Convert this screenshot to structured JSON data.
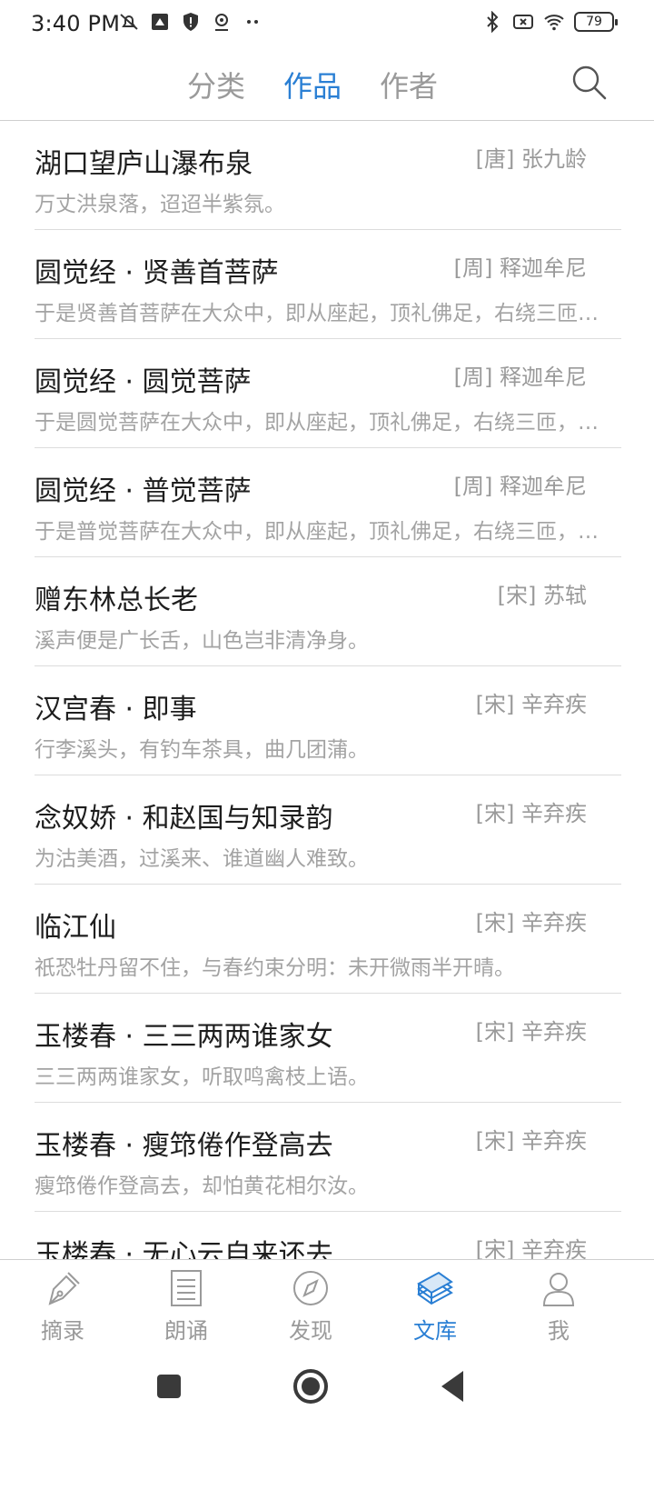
{
  "status_bar": {
    "time": "3:40 PM",
    "battery": "79",
    "left_icons": [
      "muted-notification-icon",
      "screen-record-icon",
      "shield-icon",
      "location-icon",
      "more-dots-icon"
    ],
    "right_icons": [
      "bluetooth-icon",
      "sim-error-icon",
      "wifi-icon",
      "battery-icon"
    ]
  },
  "header": {
    "tabs": [
      {
        "label": "分类",
        "active": false
      },
      {
        "label": "作品",
        "active": true
      },
      {
        "label": "作者",
        "active": false
      }
    ],
    "search_icon": "search-icon"
  },
  "works": [
    {
      "title": "湖口望庐山瀑布泉",
      "author": "[唐] 张九龄",
      "excerpt": "万丈洪泉落，迢迢半紫氛。"
    },
    {
      "title": "圆觉经 · 贤善首菩萨",
      "author": "[周] 释迦牟尼",
      "excerpt": "于是贤善首菩萨在大众中，即从座起，顶礼佛足，右绕三匝…"
    },
    {
      "title": "圆觉经 · 圆觉菩萨",
      "author": "[周] 释迦牟尼",
      "excerpt": "于是圆觉菩萨在大众中，即从座起，顶礼佛足，右绕三匝，…"
    },
    {
      "title": "圆觉经 · 普觉菩萨",
      "author": "[周] 释迦牟尼",
      "excerpt": "于是普觉菩萨在大众中，即从座起，顶礼佛足，右绕三匝，…"
    },
    {
      "title": "赠东林总长老",
      "author": "[宋] 苏轼",
      "excerpt": "溪声便是广长舌，山色岂非清净身。"
    },
    {
      "title": "汉宫春 · 即事",
      "author": "[宋] 辛弃疾",
      "excerpt": "行李溪头，有钓车茶具，曲几团蒲。"
    },
    {
      "title": "念奴娇 · 和赵国与知录韵",
      "author": "[宋] 辛弃疾",
      "excerpt": "为沽美酒，过溪来、谁道幽人难致。"
    },
    {
      "title": "临江仙",
      "author": "[宋] 辛弃疾",
      "excerpt": "祇恐牡丹留不住，与春约束分明：未开微雨半开晴。"
    },
    {
      "title": "玉楼春 · 三三两两谁家女",
      "author": "[宋] 辛弃疾",
      "excerpt": "三三两两谁家女，听取鸣禽枝上语。"
    },
    {
      "title": "玉楼春 · 瘦筇倦作登高去",
      "author": "[宋] 辛弃疾",
      "excerpt": "瘦筇倦作登高去，却怕黄花相尔汝。"
    },
    {
      "title": "玉楼春 · 无心云自来还去",
      "author": "[宋] 辛弃疾",
      "excerpt": ""
    }
  ],
  "bottom_nav": [
    {
      "label": "摘录",
      "icon": "pen-icon",
      "active": false
    },
    {
      "label": "朗诵",
      "icon": "document-icon",
      "active": false
    },
    {
      "label": "发现",
      "icon": "compass-icon",
      "active": false
    },
    {
      "label": "文库",
      "icon": "books-icon",
      "active": true
    },
    {
      "label": "我",
      "icon": "user-icon",
      "active": false
    }
  ],
  "colors": {
    "accent": "#2a7fd4",
    "muted_text": "#9a9a9a",
    "divider": "#dcdcdc"
  }
}
